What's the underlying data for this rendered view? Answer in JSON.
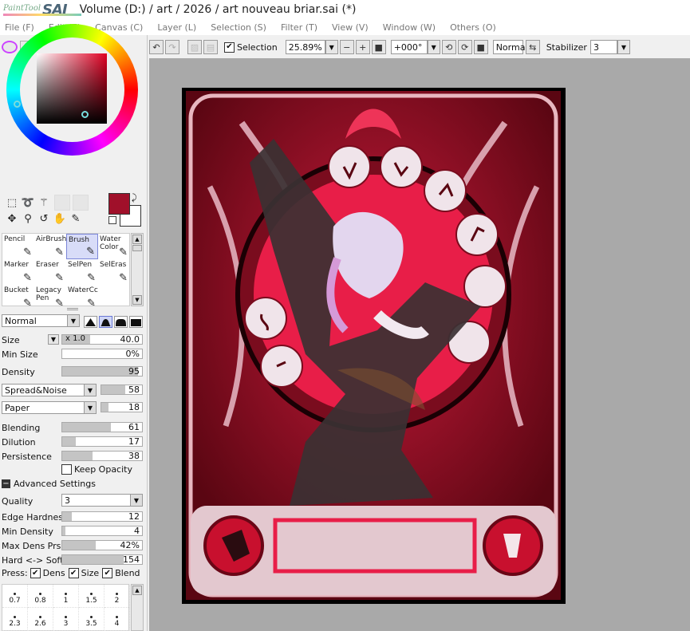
{
  "app": {
    "logo_small": "PaintTool",
    "logo_big": "SAI",
    "window_title": "Volume (D:) / art / 2026 / art nouveau briar.sai (*)"
  },
  "menu": [
    {
      "label": "File (F)"
    },
    {
      "label": "Edit (E)"
    },
    {
      "label": "Canvas (C)"
    },
    {
      "label": "Layer (L)"
    },
    {
      "label": "Selection (S)"
    },
    {
      "label": "Filter (T)"
    },
    {
      "label": "View (V)"
    },
    {
      "label": "Window (W)"
    },
    {
      "label": "Others (O)"
    }
  ],
  "toolbar": {
    "selection_label": "Selection",
    "selection_checked": true,
    "zoom": "25.89%",
    "rotation": "+000°",
    "blend_mode": "Normal",
    "stabilizer_label": "Stabilizer",
    "stabilizer_value": "3"
  },
  "colors": {
    "foreground": "#a0102a",
    "background": "#ffffff"
  },
  "brushes": [
    {
      "label": "Pencil",
      "icon": "pencil-icon"
    },
    {
      "label": "AirBrush",
      "icon": "airbrush-icon"
    },
    {
      "label": "Brush",
      "icon": "brush-icon",
      "selected": true
    },
    {
      "label": "Water Color",
      "icon": "watercolor-icon"
    },
    {
      "label": "Marker",
      "icon": "marker-icon"
    },
    {
      "label": "Eraser",
      "icon": "eraser-icon"
    },
    {
      "label": "SelPen",
      "icon": "selpen-icon"
    },
    {
      "label": "SelEras",
      "icon": "seleras-icon"
    },
    {
      "label": "Bucket",
      "icon": "bucket-icon"
    },
    {
      "label": "Legacy Pen",
      "icon": "legacy-pen-icon"
    },
    {
      "label": "WaterCc",
      "icon": "watercolor-icon"
    }
  ],
  "brush_settings": {
    "mode": "Normal",
    "size_label": "Size",
    "size_mult": "x 1.0",
    "size_value": "40.0",
    "min_size_label": "Min Size",
    "min_size_value": "0%",
    "density_label": "Density",
    "density_value": "95",
    "texture1": "Spread&Noise",
    "texture1_value": "58",
    "texture2": "Paper",
    "texture2_value": "18",
    "blending_label": "Blending",
    "blending_value": "61",
    "dilution_label": "Dilution",
    "dilution_value": "17",
    "persistence_label": "Persistence",
    "persistence_value": "38",
    "keep_opacity_label": "Keep Opacity",
    "advanced_label": "Advanced Settings",
    "quality_label": "Quality",
    "quality_value": "3",
    "edge_hardness_label": "Edge Hardness",
    "edge_hardness_value": "12",
    "min_density_label": "Min Density",
    "min_density_value": "4",
    "max_dens_prs_label": "Max Dens Prs.",
    "max_dens_prs_value": "42%",
    "hard_soft_label": "Hard <-> Soft",
    "hard_soft_value": "154",
    "press_label": "Press:",
    "press_dens": "Dens",
    "press_size": "Size",
    "press_blend": "Blend"
  },
  "brush_fills": {
    "size": 0.35,
    "min_size": 0.0,
    "density": 0.95,
    "texture1": 0.58,
    "texture2": 0.18,
    "blending": 0.61,
    "dilution": 0.17,
    "persistence": 0.38,
    "edge_hardness": 0.12,
    "min_density": 0.04,
    "max_dens_prs": 0.42,
    "hard_soft": 0.77
  },
  "dot_sizes_row1": [
    "0.7",
    "0.8",
    "1",
    "1.5",
    "2"
  ],
  "dot_sizes_row2": [
    "2.3",
    "2.6",
    "3",
    "3.5",
    "4"
  ]
}
